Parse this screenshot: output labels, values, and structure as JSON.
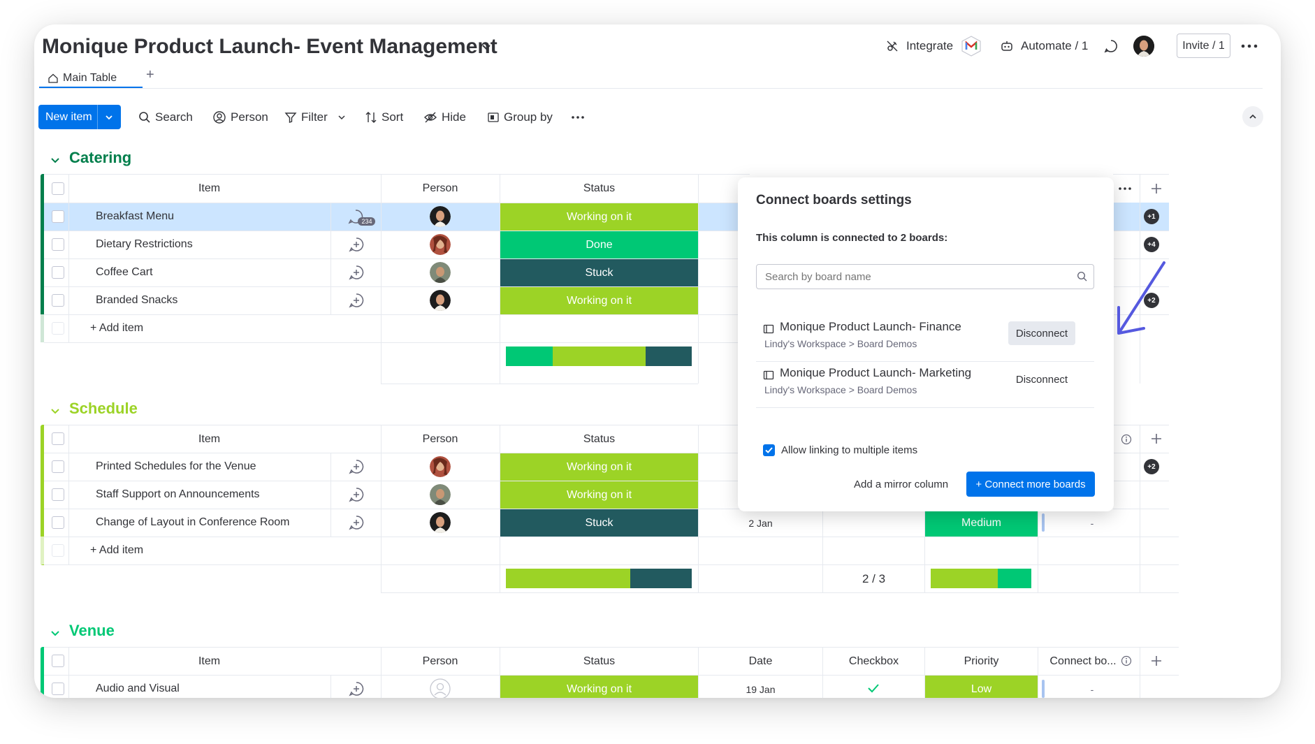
{
  "board": {
    "title": "Monique Product Launch- Event Management",
    "integrate_label": "Integrate",
    "automate_label": "Automate / 1",
    "invite_label": "Invite / 1"
  },
  "tabs": {
    "main": "Main Table",
    "add": "+"
  },
  "toolbar": {
    "new_item": "New item",
    "search": "Search",
    "person": "Person",
    "filter": "Filter",
    "sort": "Sort",
    "hide": "Hide",
    "group_by": "Group by"
  },
  "columns": {
    "item": "Item",
    "person": "Person",
    "status": "Status",
    "date": "Date",
    "checkbox": "Checkbox",
    "priority": "Priority",
    "connect": "Connect bo..."
  },
  "groups": [
    {
      "name": "Catering",
      "color": "#037f4c",
      "rows": [
        {
          "item": "Breakfast Menu",
          "status": "Working on it",
          "status_color": "#9cd326",
          "updates": "234",
          "connect_badge": "+1"
        },
        {
          "item": "Dietary Restrictions",
          "status": "Done",
          "status_color": "#00c875",
          "connect_badge": "+4"
        },
        {
          "item": "Coffee Cart",
          "status": "Stuck",
          "status_color": "#225a5f",
          "connect_badge": ""
        },
        {
          "item": "Branded Snacks",
          "status": "Working on it",
          "status_color": "#9cd326",
          "connect_badge": "+2"
        }
      ],
      "add_item": "+ Add item",
      "status_summary": [
        0.25,
        0.5,
        0.25
      ]
    },
    {
      "name": "Schedule",
      "color": "#9cd326",
      "rows": [
        {
          "item": "Printed Schedules for the Venue",
          "status": "Working on it",
          "status_color": "#9cd326",
          "connect_badge": "+2"
        },
        {
          "item": "Staff Support on Announcements",
          "status": "Working on it",
          "status_color": "#9cd326",
          "connect_badge": ""
        },
        {
          "item": "Change of Layout in Conference Room",
          "status": "Stuck",
          "status_color": "#225a5f",
          "date": "2 Jan",
          "priority": "Medium",
          "priority_color": "#00c875",
          "connect": "-"
        }
      ],
      "add_item": "+ Add item",
      "status_summary": [
        0.67,
        0.33
      ],
      "checkbox_summary": "2 / 3",
      "priority_summary": [
        0.67,
        0.33
      ]
    },
    {
      "name": "Venue",
      "color": "#00c875",
      "rows": [
        {
          "item": "Audio and Visual",
          "status": "Working on it",
          "status_color": "#9cd326",
          "date": "19 Jan",
          "checked": true,
          "priority": "Low",
          "priority_color": "#9cd326",
          "connect": "-"
        }
      ]
    }
  ],
  "popup": {
    "title": "Connect boards settings",
    "subtitle": "This column is connected to 2 boards:",
    "search_placeholder": "Search by board name",
    "boards": [
      {
        "name": "Monique Product Launch- Finance",
        "path": "Lindy's Workspace > Board Demos",
        "action": "Disconnect"
      },
      {
        "name": "Monique Product Launch- Marketing",
        "path": "Lindy's Workspace > Board Demos",
        "action": "Disconnect"
      }
    ],
    "allow_multiple": "Allow linking to multiple items",
    "mirror": "Add a mirror column",
    "connect_more": "+ Connect more boards"
  },
  "colors": {
    "accent": "#0073ea",
    "working": "#9cd326",
    "done": "#00c875",
    "stuck": "#225a5f",
    "arrow": "#5559df"
  }
}
